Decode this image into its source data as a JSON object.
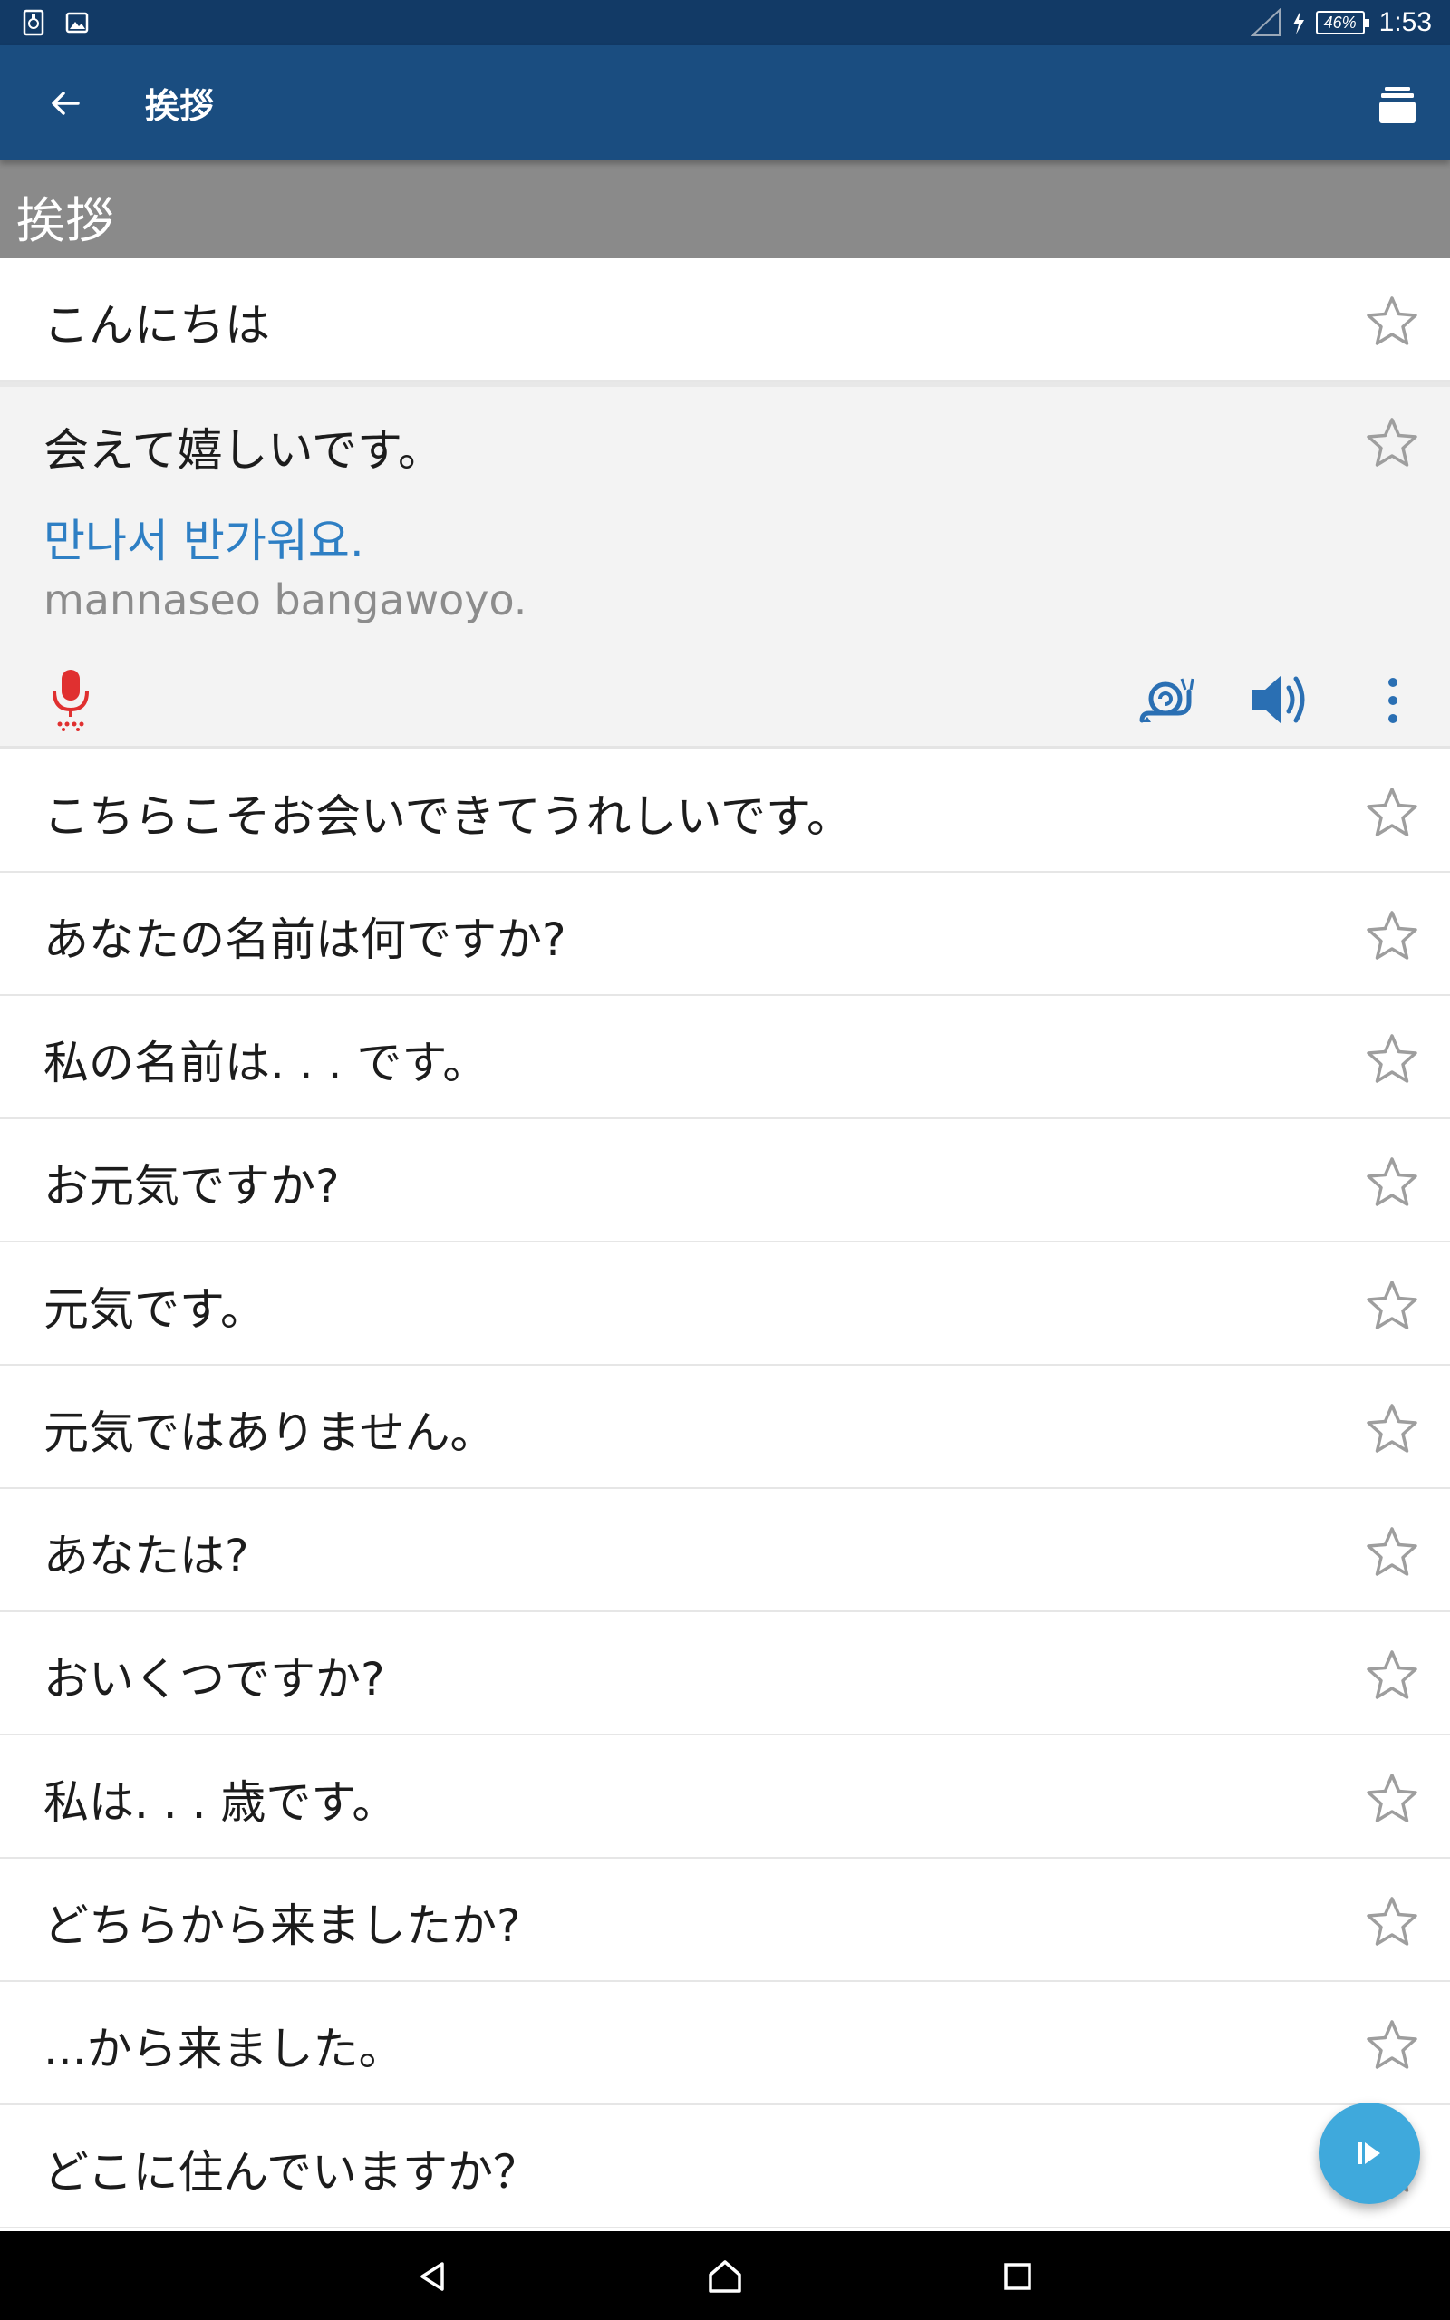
{
  "status_bar": {
    "battery": "46%",
    "time": "1:53",
    "icons": [
      "sim-card-icon",
      "image-icon",
      "signal-icon",
      "charging-icon",
      "battery-icon"
    ]
  },
  "app_bar": {
    "title": "挨拶",
    "back_icon": "arrow-back-icon",
    "action_icon": "flashcards-icon"
  },
  "category": {
    "title": "挨拶"
  },
  "phrases": [
    {
      "text": "こんにちは"
    },
    {
      "text": "会えて嬉しいです。",
      "translation": "만나서 반가워요.",
      "romanization": "mannaseo bangawoyo."
    },
    {
      "text": "こちらこそお会いできてうれしいです。"
    },
    {
      "text": "あなたの名前は何ですか?"
    },
    {
      "text": "私の名前は. . . です。"
    },
    {
      "text": "お元気ですか?"
    },
    {
      "text": "元気です。"
    },
    {
      "text": "元気ではありません。"
    },
    {
      "text": "あなたは?"
    },
    {
      "text": "おいくつですか?"
    },
    {
      "text": "私は. . .  歳です。"
    },
    {
      "text": "どちらから来ましたか?"
    },
    {
      "text": "...から来ました。"
    },
    {
      "text": "どこに住んでいますか？"
    }
  ],
  "colors": {
    "status_bar": "#123a66",
    "app_bar": "#1a4d80",
    "category_header": "#8a8a8a",
    "translation": "#2e7fc4",
    "mic": "#e03030",
    "action_icons": "#2a6fb3",
    "fab": "#3fa9dc"
  }
}
